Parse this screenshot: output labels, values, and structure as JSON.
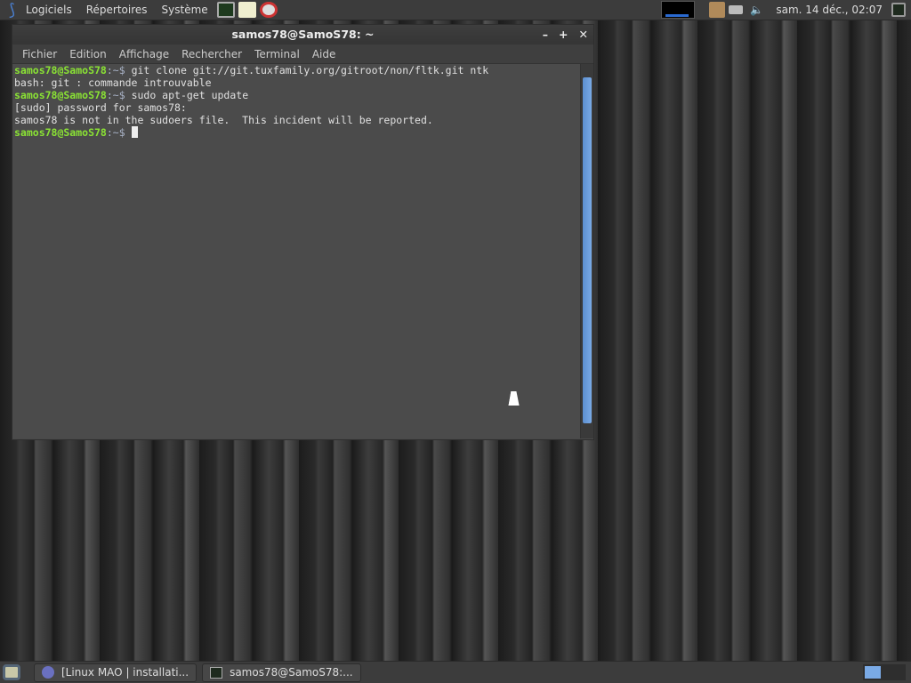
{
  "top_panel": {
    "menus": [
      "Logiciels",
      "Répertoires",
      "Système"
    ],
    "clock": "sam. 14 déc., 02:07"
  },
  "window": {
    "title": "samos78@SamoS78: ~",
    "menu": [
      "Fichier",
      "Edition",
      "Affichage",
      "Rechercher",
      "Terminal",
      "Aide"
    ],
    "lines": [
      {
        "prompt": "samos78@SamoS78",
        "path": ":~$",
        "cmd": " git clone git://git.tuxfamily.org/gitroot/non/fltk.git ntk"
      },
      {
        "text": "bash: git : commande introuvable"
      },
      {
        "prompt": "samos78@SamoS78",
        "path": ":~$",
        "cmd": " sudo apt-get update"
      },
      {
        "text": "[sudo] password for samos78:"
      },
      {
        "text": "samos78 is not in the sudoers file.  This incident will be reported."
      },
      {
        "prompt": "samos78@SamoS78",
        "path": ":~$",
        "cmd": " "
      }
    ]
  },
  "taskbar": {
    "tasks": [
      "[Linux MAO | installati...",
      "samos78@SamoS78:..."
    ]
  }
}
